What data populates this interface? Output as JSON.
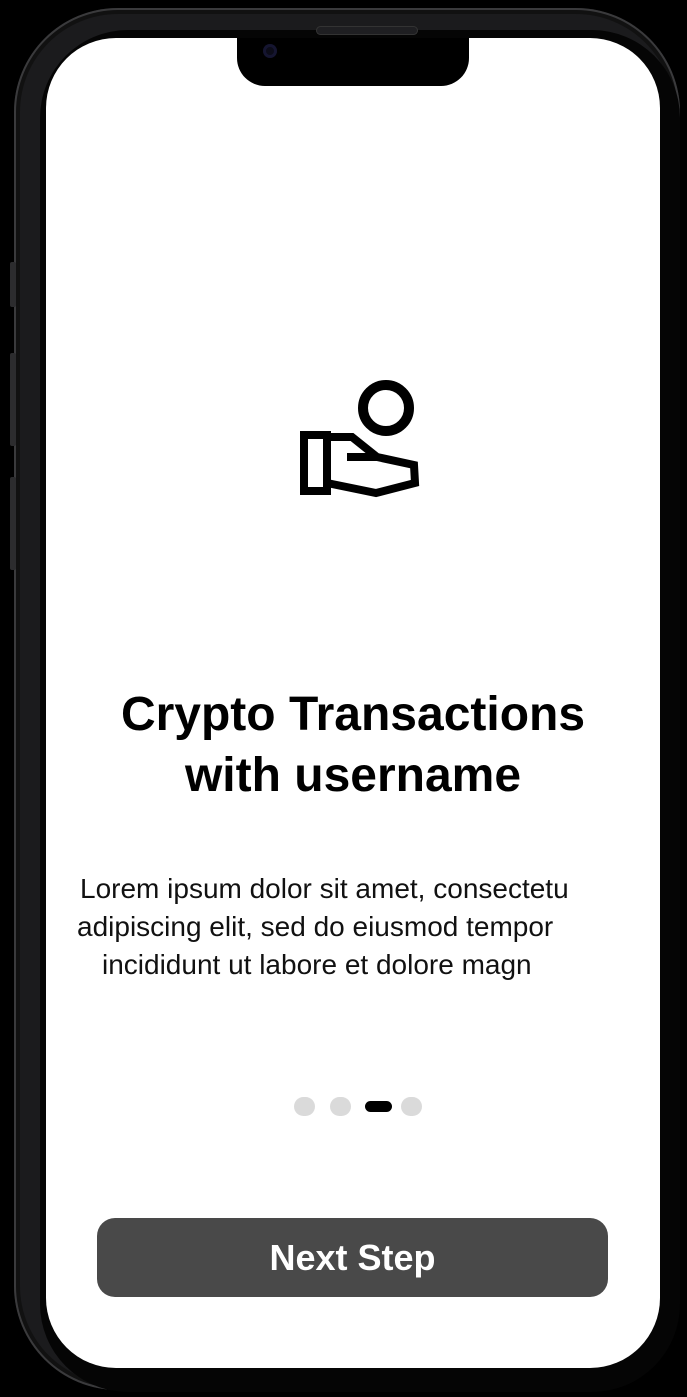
{
  "onboarding": {
    "icon": "hand-coin-icon",
    "title_line1": "Crypto Transactions",
    "title_line2": "with username",
    "description_line1": "Lorem ipsum dolor sit amet, consectetu",
    "description_line2": "adipiscing elit, sed do eiusmod tempor",
    "description_line3": "incididunt ut labore et dolore magn",
    "pager": {
      "total": 4,
      "current": 3
    },
    "next_button_label": "Next Step"
  },
  "colors": {
    "screen_background": "#ffffff",
    "button_background": "#494949",
    "dot_inactive": "#dadada",
    "dot_active": "#000000"
  }
}
